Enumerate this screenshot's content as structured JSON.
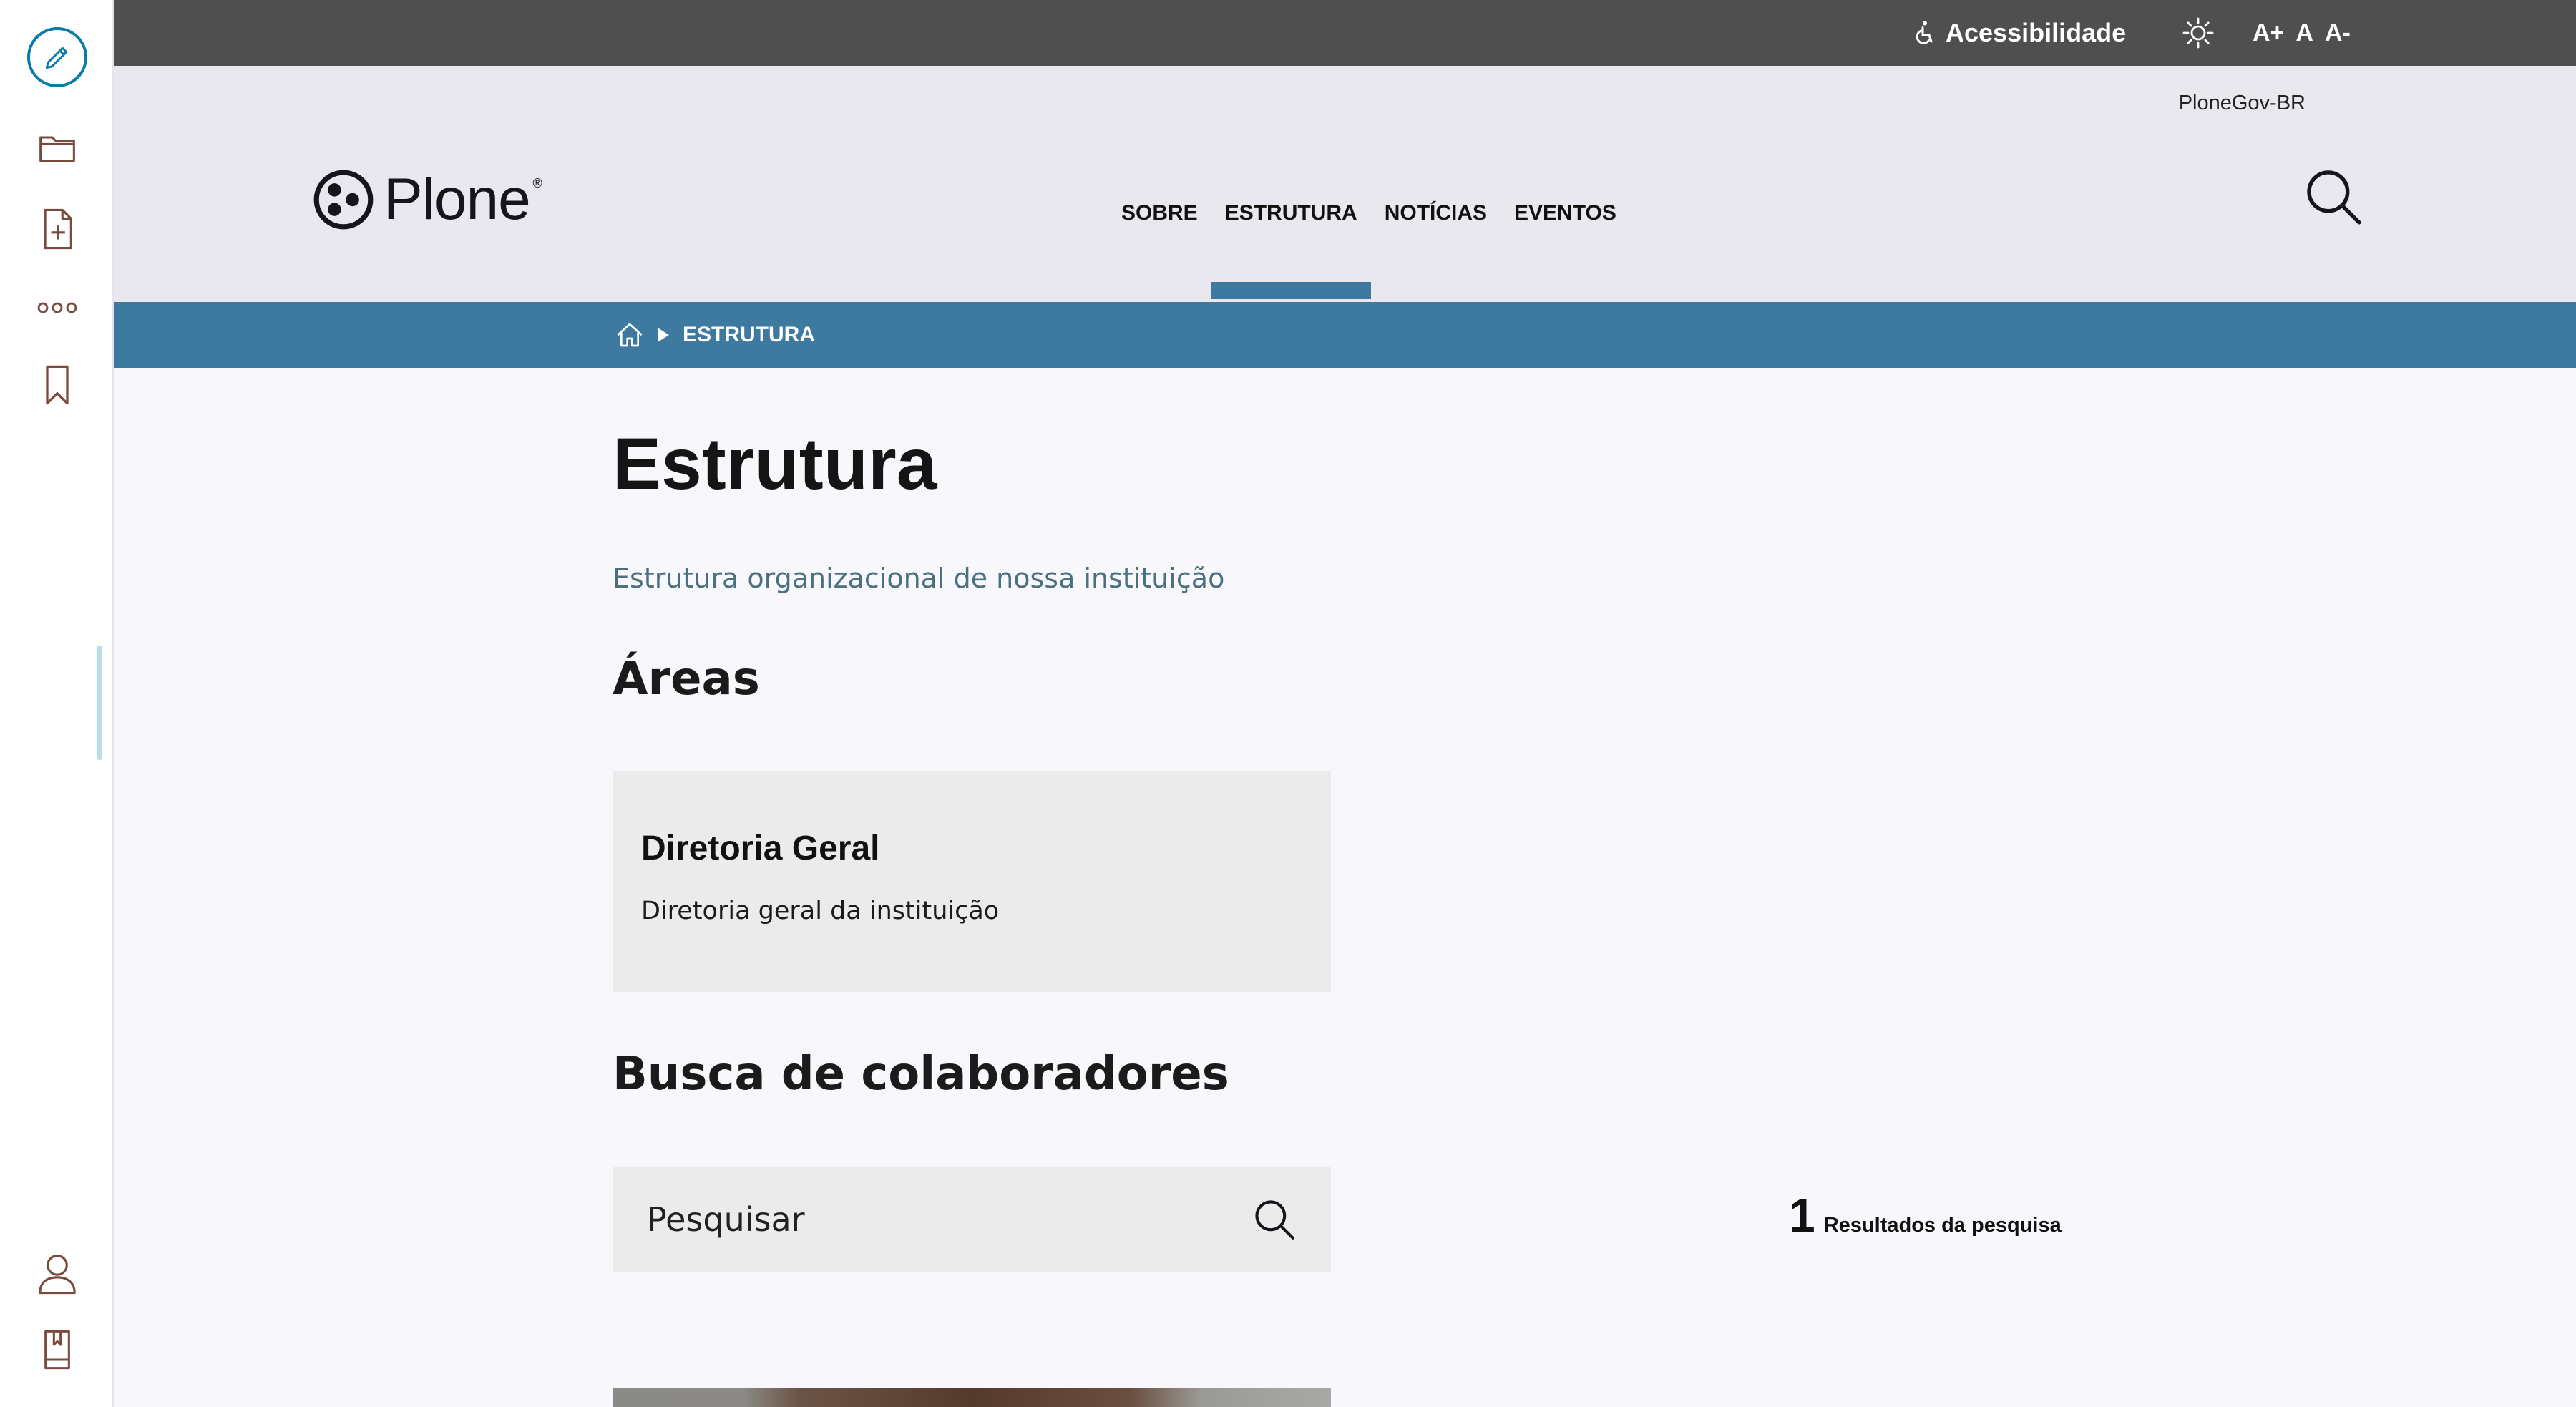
{
  "topbar": {
    "accessibility_label": "Acessibilidade",
    "font_increase": "A+",
    "font_default": "A",
    "font_decrease": "A-",
    "background_color": "#4f4f4f"
  },
  "header": {
    "site_name": "PloneGov-BR",
    "logo_text": "Plone",
    "logo_mark": "®",
    "nav": [
      {
        "label": "SOBRE"
      },
      {
        "label": "ESTRUTURA"
      },
      {
        "label": "NOTÍCIAS"
      },
      {
        "label": "EVENTOS"
      }
    ],
    "active_nav": "ESTRUTURA",
    "accent_color": "#3e7aa0"
  },
  "breadcrumb": {
    "current": "ESTRUTURA"
  },
  "page": {
    "title": "Estrutura",
    "description": "Estrutura organizacional de nossa instituição",
    "areas_heading": "Áreas",
    "area_card": {
      "title": "Diretoria Geral",
      "description": "Diretoria geral da instituição"
    },
    "search_heading": "Busca de colaboradores",
    "search_placeholder": "Pesquisar",
    "results_count": "1",
    "results_label": "Resultados da pesquisa"
  },
  "toolbar": {
    "icons": [
      "edit-icon",
      "folder-icon",
      "add-document-icon",
      "more-icon",
      "bookmark-icon",
      "user-icon",
      "book-icon"
    ]
  }
}
